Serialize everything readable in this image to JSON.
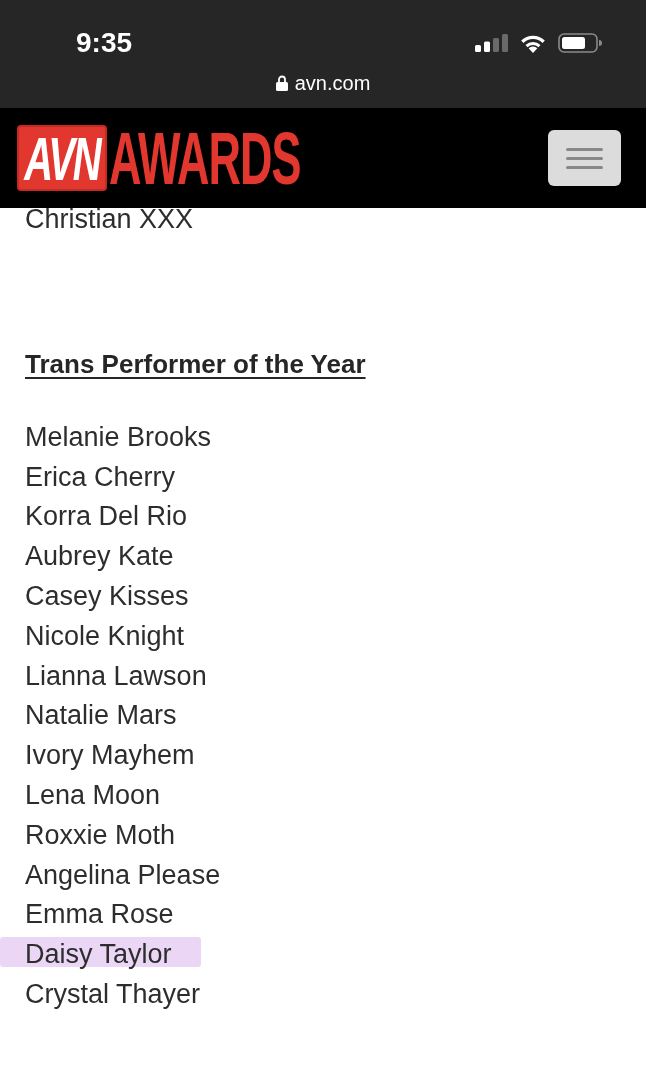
{
  "status_bar": {
    "time": "9:35"
  },
  "browser": {
    "url": "avn.com"
  },
  "header": {
    "logo": {
      "badge": "AVN",
      "word": "AWARDS"
    }
  },
  "content": {
    "previous_item": "Christian XXX",
    "category": {
      "title": "Trans Performer of the Year",
      "nominees": [
        {
          "name": "Melanie Brooks",
          "highlighted": false
        },
        {
          "name": "Erica Cherry",
          "highlighted": false
        },
        {
          "name": "Korra Del Rio",
          "highlighted": false
        },
        {
          "name": "Aubrey Kate",
          "highlighted": false
        },
        {
          "name": "Casey Kisses",
          "highlighted": false
        },
        {
          "name": "Nicole Knight",
          "highlighted": false
        },
        {
          "name": "Lianna Lawson",
          "highlighted": false
        },
        {
          "name": "Natalie Mars",
          "highlighted": false
        },
        {
          "name": "Ivory Mayhem",
          "highlighted": false
        },
        {
          "name": "Lena Moon",
          "highlighted": false
        },
        {
          "name": "Roxxie Moth",
          "highlighted": false
        },
        {
          "name": "Angelina Please",
          "highlighted": false
        },
        {
          "name": "Emma Rose",
          "highlighted": false
        },
        {
          "name": "Daisy Taylor",
          "highlighted": true
        },
        {
          "name": "Crystal Thayer",
          "highlighted": false
        }
      ]
    }
  }
}
